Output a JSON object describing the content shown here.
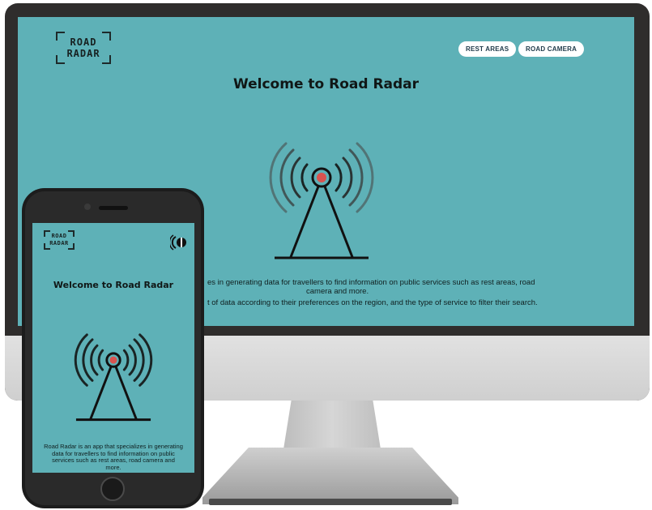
{
  "app": {
    "logo_line1": "ROAD",
    "logo_line2": "RADAR",
    "accent": "#5eb1b7",
    "signal_dot": "#d9534f"
  },
  "desktop": {
    "nav": {
      "rest_areas": "REST AREAS",
      "road_camera": "ROAD CAMERA"
    },
    "title": "Welcome to Road Radar",
    "desc_line1": "es in generating data for travellers to find information on public services such as rest areas, road",
    "desc_line2": "camera and more.",
    "desc_line3": "t of data according to their preferences on the region, and the type of service to filter their search."
  },
  "mobile": {
    "title": "Welcome to Road Radar",
    "description": "Road Radar is an app that specializes in generating data for travellers to find information on public services such as rest areas, road camera and more.",
    "menu_icon": "menu-toggle-icon"
  }
}
